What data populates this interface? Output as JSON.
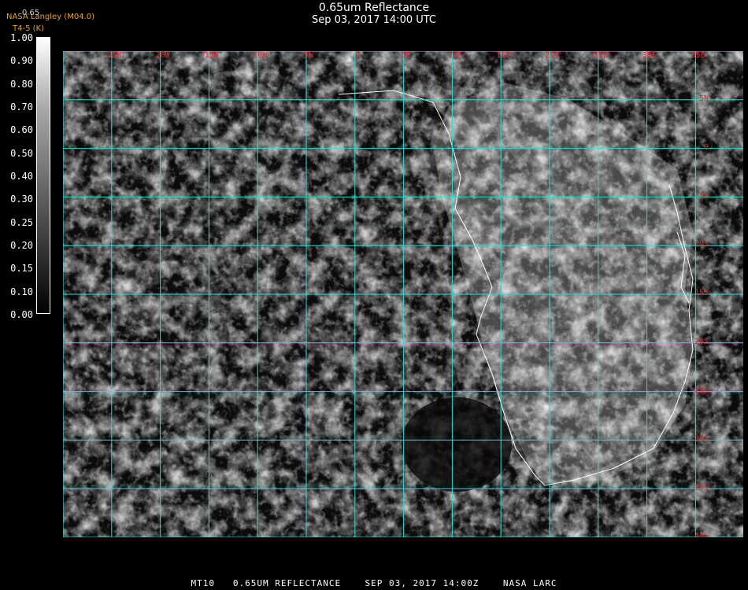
{
  "header": {
    "title": "0.65um Reflectance",
    "subtitle": "Sep 03, 2017 14:00 UTC",
    "credit": "NASA Langley (M04.0)",
    "scale_label": "T4-5 (K)",
    "scale_top": "0.65"
  },
  "colorbar": {
    "ticks": [
      "1.00",
      "0.90",
      "0.80",
      "0.70",
      "0.60",
      "0.50",
      "0.40",
      "0.30",
      "0.25",
      "0.20",
      "0.15",
      "0.10",
      "0.00"
    ]
  },
  "map": {
    "longitudes": [
      "25W",
      "20W",
      "15W",
      "10W",
      "5W",
      "0",
      "5E",
      "10E",
      "15E",
      "20E",
      "25E",
      "30E",
      "35E"
    ],
    "latitudes": [
      "5N",
      "0",
      "5S",
      "10S",
      "15S",
      "20S",
      "25S",
      "30S",
      "35S",
      "40S"
    ],
    "grid_color": "#33d6d6",
    "coast_color": "#ffffff",
    "label_color": "#d23030"
  },
  "footer": "MT10   0.65UM REFLECTANCE    SEP 03, 2017 14:00Z    NASA LARC"
}
